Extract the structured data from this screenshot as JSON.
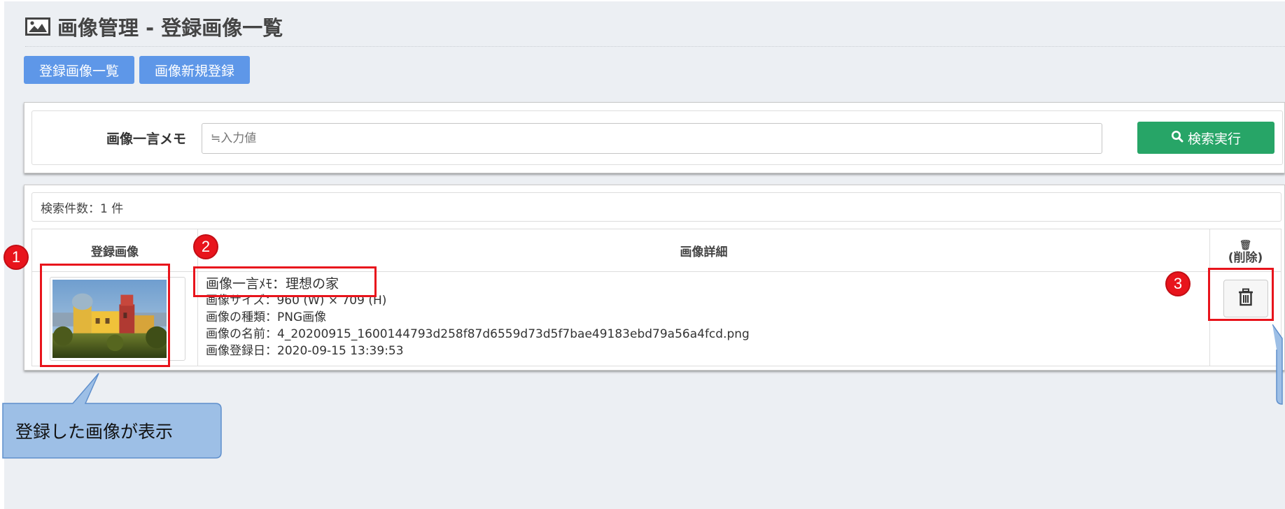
{
  "page": {
    "title": "画像管理 - 登録画像一覧",
    "title_icon": "picture-icon"
  },
  "tabs": [
    {
      "label": "登録画像一覧"
    },
    {
      "label": "画像新規登録"
    }
  ],
  "search": {
    "label": "画像一言メモ",
    "placeholder": "≒入力値",
    "button_label": "検索実行",
    "button_icon": "search-icon"
  },
  "results": {
    "count_text": "検索件数：1 件",
    "headers": {
      "image": "登録画像",
      "detail": "画像詳細",
      "delete_line1": "🗑",
      "delete_line2": "(削除)"
    },
    "rows": [
      {
        "memo": "画像一言ﾒﾓ：理想の家",
        "size": "画像サイズ：960 (W) × 709 (H)",
        "type": "画像の種類：PNG画像",
        "name": "画像の名前：4_20200915_1600144793d258f87d6559d73d5f7bae49183ebd79a56a4fcd.png",
        "date": "画像登録日：2020-09-15 13:39:53",
        "delete_icon": "trash-icon"
      }
    ]
  },
  "annotations": {
    "badges": [
      "1",
      "2",
      "3"
    ],
    "callout": "登録した画像が表示"
  },
  "colors": {
    "tab_blue": "#5e97e8",
    "search_green": "#27a567",
    "highlight_red": "#e8141c",
    "callout_fill": "#9dbfe6",
    "background": "#eceff3"
  }
}
